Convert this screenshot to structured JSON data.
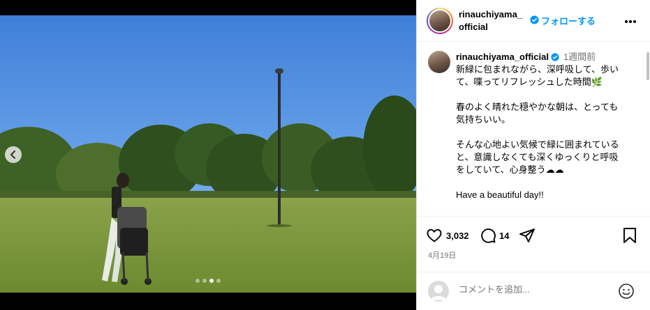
{
  "post": {
    "username": "rinauchiyama_official",
    "follow_label": "フォローする",
    "time_ago": "1週間前",
    "caption": [
      "新緑に包まれながら、深呼吸して、歩いて、喋ってリフレッシュした時間🌿",
      "春のよく晴れた穏やかな朝は、とっても気持ちいい。",
      "そんな心地よい気候で緑に囲まれていると、意識しなくても深くゆっくりと呼吸をしていて、心身整う☁☁",
      "Have a beautiful day!!"
    ],
    "likes": "3,032",
    "comments": "14",
    "date": "4月19日",
    "comment_placeholder": "コメントを追加..."
  },
  "carousel": {
    "count": 4,
    "active": 3
  },
  "icons": {
    "verified": "verified-badge-icon",
    "more": "more-options-icon",
    "like": "heart-icon",
    "comment": "comment-bubble-icon",
    "share": "paper-plane-icon",
    "save": "bookmark-icon",
    "emoji": "smiley-icon",
    "prev": "chevron-left-icon"
  },
  "colors": {
    "accent": "#0095f6",
    "muted": "#737373",
    "border": "#dbdbdb"
  }
}
